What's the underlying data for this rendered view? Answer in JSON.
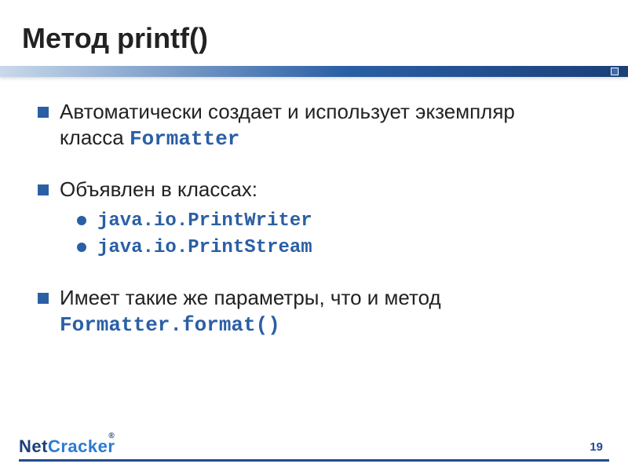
{
  "title": "Метод printf()",
  "bullets": {
    "b1_prefix": "Автоматически создает и использует экземпляр класса ",
    "b1_code": "Formatter",
    "b2_text": "Объявлен в классах:",
    "b2_sub1": "java.io.PrintWriter",
    "b2_sub2": "java.io.PrintStream",
    "b3_prefix": "Имеет такие же параметры, что и метод ",
    "b3_code": "Formatter.format()"
  },
  "footer": {
    "logo_net": "Net",
    "logo_cracker": "Cracker",
    "logo_reg": "®",
    "page": "19"
  }
}
